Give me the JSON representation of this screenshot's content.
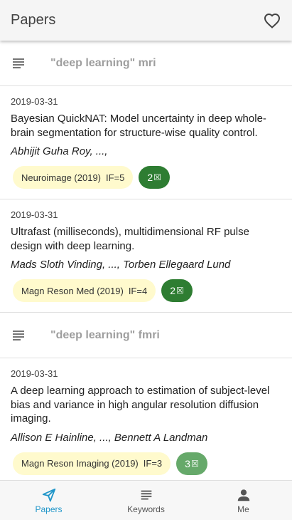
{
  "header": {
    "title": "Papers"
  },
  "groups": [
    {
      "query": "\"deep learning\" mri",
      "papers": [
        {
          "date": "2019-03-31",
          "title": "Bayesian QuickNAT: Model uncertainty in deep whole-brain segmentation for structure-wise quality control.",
          "authors": "Abhijit Guha Roy, ...,",
          "journal": "Neuroimage (2019)",
          "impact": "IF=5",
          "count": "2"
        },
        {
          "date": "2019-03-31",
          "title": "Ultrafast (milliseconds), multidimensional RF pulse design with deep learning.",
          "authors": "Mads Sloth Vinding, ..., Torben Ellegaard Lund",
          "journal": "Magn Reson Med (2019)",
          "impact": "IF=4",
          "count": "2"
        }
      ]
    },
    {
      "query": "\"deep learning\" fmri",
      "papers": [
        {
          "date": "2019-03-31",
          "title": "A deep learning approach to estimation of subject-level bias and variance in high angular resolution diffusion imaging.",
          "authors": "Allison E Hainline, ..., Bennett A Landman",
          "journal": "Magn Reson Imaging (2019)",
          "impact": "IF=3",
          "count": "3"
        }
      ]
    }
  ],
  "nav": {
    "items": [
      {
        "label": "Papers",
        "icon": "send-icon",
        "active": true
      },
      {
        "label": "Keywords",
        "icon": "list-icon",
        "active": false
      },
      {
        "label": "Me",
        "icon": "person-icon",
        "active": false
      }
    ]
  },
  "colors": {
    "accent": "#2196c9",
    "count_chip": "#2e7d32",
    "journal_chip": "#fffacd"
  }
}
